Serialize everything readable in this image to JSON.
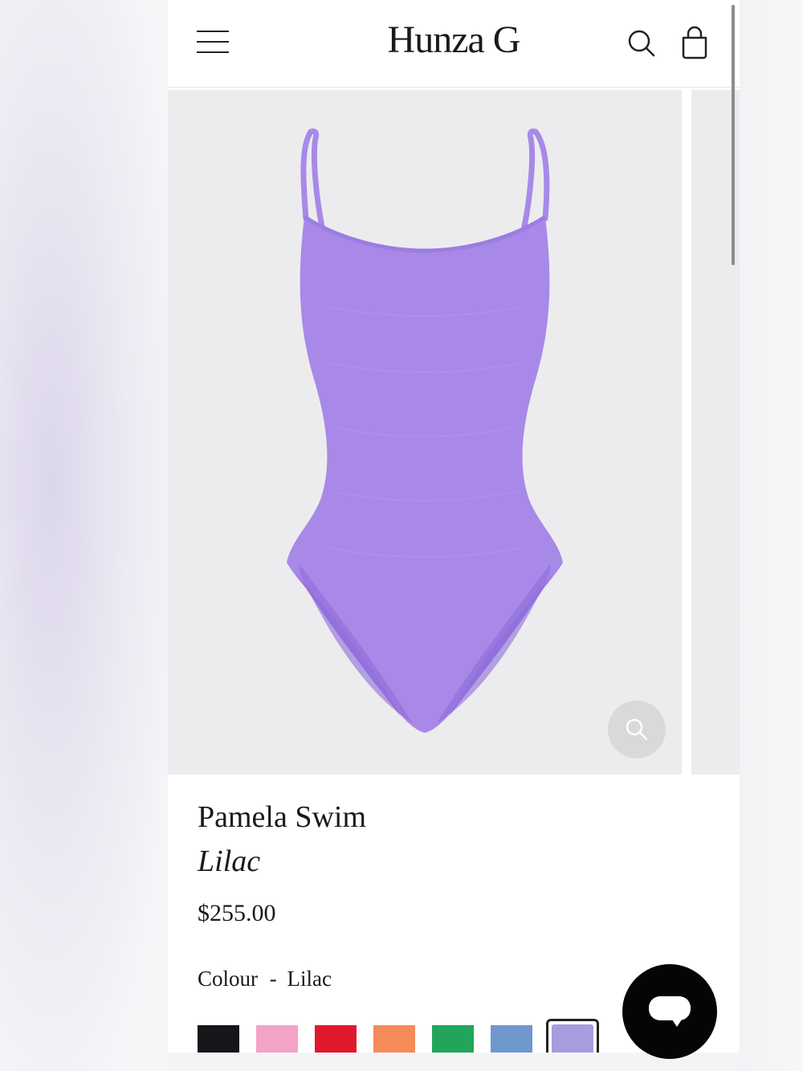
{
  "header": {
    "brand": "Hunza G",
    "icons": [
      "menu-icon",
      "search-icon",
      "shopping-bag-icon"
    ]
  },
  "product": {
    "title": "Pamela Swim",
    "variant": "Lilac",
    "price": "$255.00",
    "colour_label": "Colour",
    "colour_separator": "-",
    "colour_value": "Lilac",
    "swimsuit_color": "#a889e8"
  },
  "swatches": [
    {
      "name": "black",
      "color": "#15151a"
    },
    {
      "name": "pink",
      "color": "#f2a3c6"
    },
    {
      "name": "red",
      "color": "#e0182c"
    },
    {
      "name": "orange",
      "color": "#f58b58"
    },
    {
      "name": "green",
      "color": "#22a55a"
    },
    {
      "name": "blue",
      "color": "#6f98cf"
    },
    {
      "name": "lilac",
      "color": "#a99be0",
      "selected": true
    }
  ],
  "colors": {
    "image_bg": "#ececee",
    "chat_button": "#050505"
  }
}
